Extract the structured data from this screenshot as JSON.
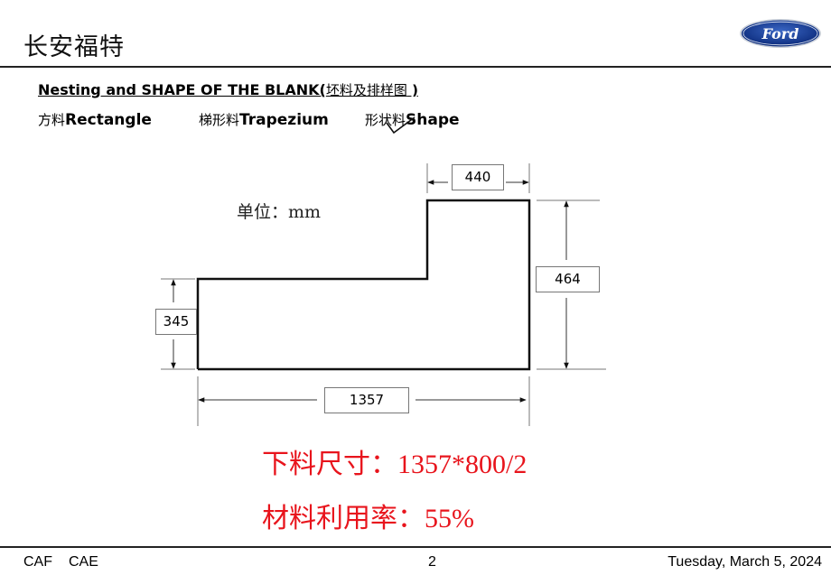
{
  "header": {
    "title": "长安福特",
    "logo_text": "Ford"
  },
  "section": {
    "heading_en": "Nesting and SHAPE OF THE BLANK(",
    "heading_cn": "坯料及排样图",
    "heading_close": " )"
  },
  "blank_types": [
    {
      "cn": "方料",
      "en": "Rectangle",
      "selected": false
    },
    {
      "cn": "梯形料",
      "en": "Trapezium",
      "selected": false
    },
    {
      "cn": "形状料",
      "en": "Shape",
      "selected": true
    }
  ],
  "drawing": {
    "unit_label": "单位：mm",
    "dimensions": {
      "top_width": "440",
      "right_height": "464",
      "left_height": "345",
      "total_width": "1357"
    }
  },
  "results": {
    "blank_size": "下料尺寸：1357*800/2",
    "utilization": "材料利用率：55%",
    "color": "#e8141c"
  },
  "footer": {
    "left_1": "CAF",
    "left_2": "CAE",
    "page_number": "2",
    "date": "Tuesday, March 5, 2024"
  }
}
